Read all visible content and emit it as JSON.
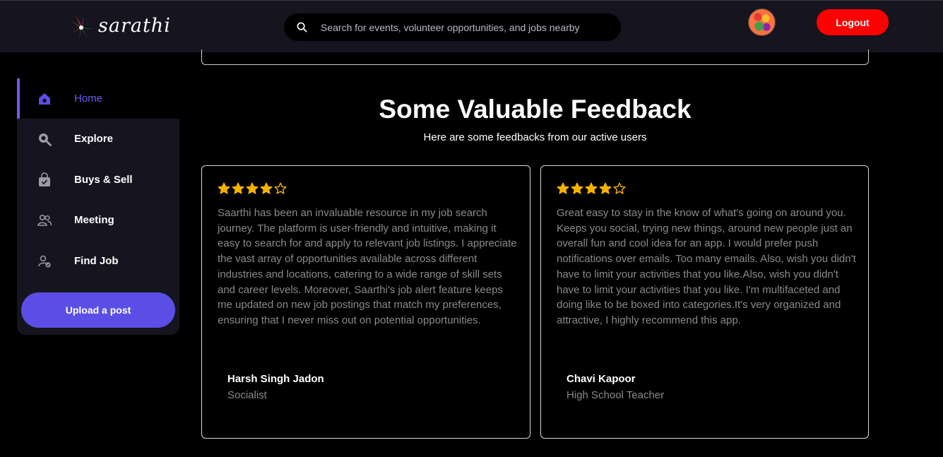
{
  "header": {
    "logo_text": "sarathi",
    "search_placeholder": "Search for events, volunteer opportunities, and jobs nearby",
    "logout_label": "Logout"
  },
  "sidebar": {
    "items": [
      {
        "label": "Home",
        "icon": "home-icon",
        "active": true
      },
      {
        "label": "Explore",
        "icon": "explore-icon"
      },
      {
        "label": "Buys & Sell",
        "icon": "shopping-bag-icon"
      },
      {
        "label": "Meeting",
        "icon": "people-icon"
      },
      {
        "label": "Find Job",
        "icon": "user-check-icon"
      }
    ],
    "upload_label": "Upload a post"
  },
  "feedback": {
    "title": "Some Valuable Feedback",
    "subtitle": "Here are some feedbacks from our active users",
    "cards": [
      {
        "rating": 4,
        "max_rating": 5,
        "review": "Saarthi has been an invaluable resource in my job search journey. The platform is user-friendly and intuitive, making it easy to search for and apply to relevant job listings. I appreciate the vast array of opportunities available across different industries and locations, catering to a wide range of skill sets and career levels. Moreover, Saarthi's job alert feature keeps me updated on new job postings that match my preferences, ensuring that I never miss out on potential opportunities.",
        "author": "Harsh Singh Jadon",
        "role": "Socialist"
      },
      {
        "rating": 4,
        "max_rating": 5,
        "review": "Great easy to stay in the know of what's going on around you. Keeps you social, trying new things, around new people just an overall fun and cool idea for an app. I would prefer push notifications over emails. Too many emails. Also, wish you didn't have to limit your activities that you like.Also, wish you didn't have to limit your activities that you like. I'm multifaceted and doing like to be boxed into categories.It's very organized and attractive, I highly recommend this app.",
        "author": "Chavi Kapoor",
        "role": "High School Teacher"
      }
    ]
  },
  "colors": {
    "accent": "#5b4ee6",
    "logout": "#ff0000",
    "star": "#f5b301",
    "header_bg": "#15141f",
    "sidebar_bg": "#16151f"
  }
}
